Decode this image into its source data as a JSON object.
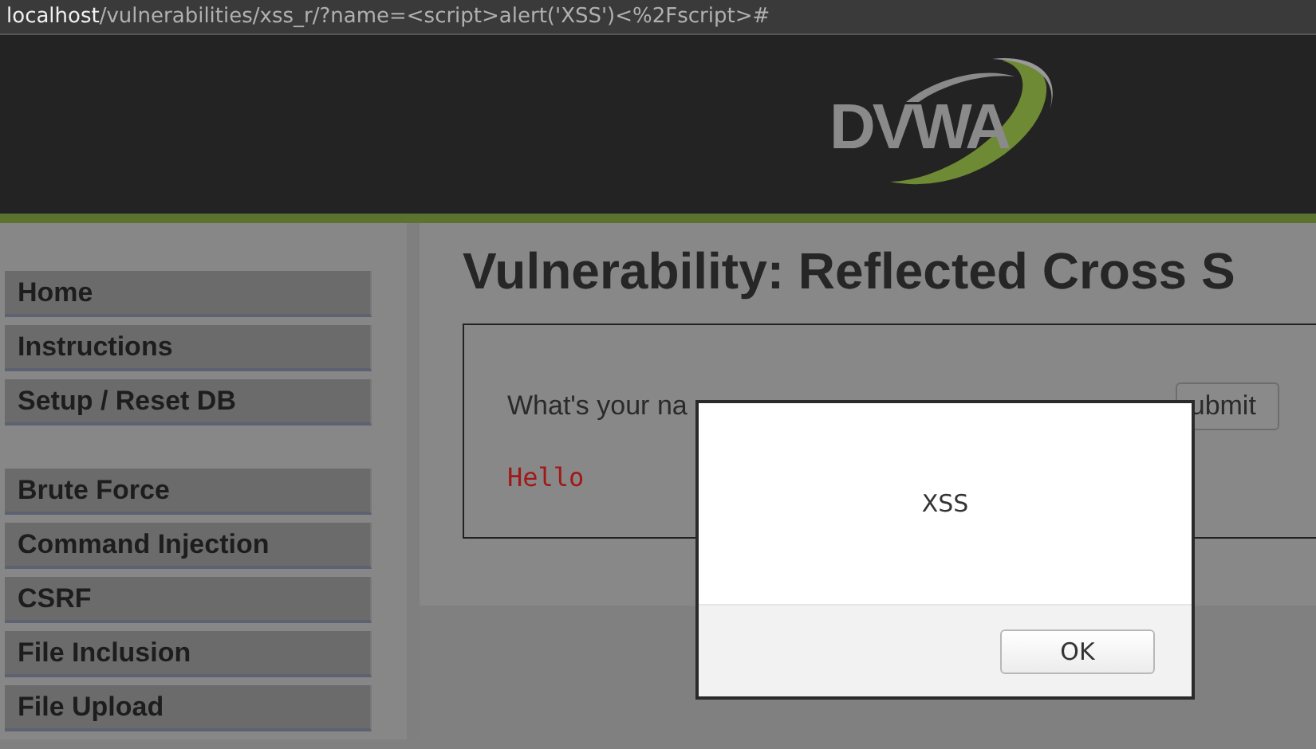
{
  "address_bar": {
    "host": "localhost",
    "path": "/vulnerabilities/xss_r/?name=<script>alert('XSS')<%2Fscript>#"
  },
  "header": {
    "logo_text": "DVWA"
  },
  "sidebar": {
    "groups": [
      {
        "items": [
          {
            "label": "Home"
          },
          {
            "label": "Instructions"
          },
          {
            "label": "Setup / Reset DB"
          }
        ]
      },
      {
        "items": [
          {
            "label": "Brute Force"
          },
          {
            "label": "Command Injection"
          },
          {
            "label": "CSRF"
          },
          {
            "label": "File Inclusion"
          },
          {
            "label": "File Upload"
          }
        ]
      }
    ]
  },
  "main": {
    "title": "Vulnerability: Reflected Cross S",
    "form": {
      "label": "What's your na",
      "submit": "ubmit"
    },
    "output": "Hello"
  },
  "dialog": {
    "message": "XSS",
    "button": "OK"
  }
}
